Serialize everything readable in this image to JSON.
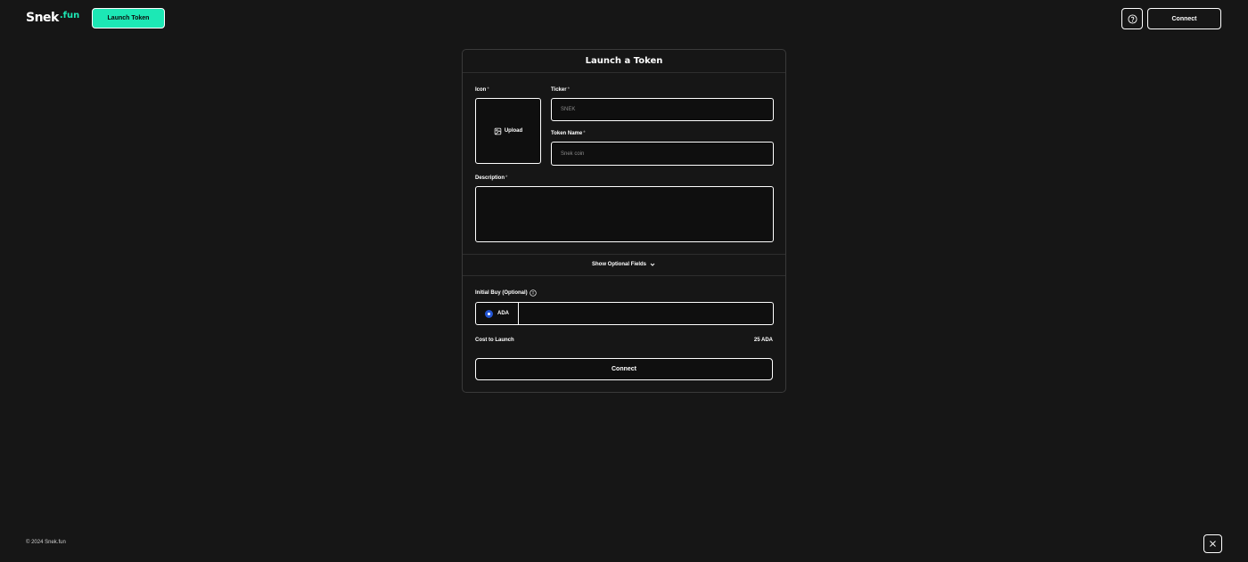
{
  "header": {
    "logo_main": "Snek",
    "logo_tld": ".fun",
    "launch_button": "Launch Token",
    "connect_button": "Connect",
    "help_icon": "question-circle-icon"
  },
  "form": {
    "title": "Launch a Token",
    "icon_label": "Icon",
    "upload_label": "Upload",
    "upload_icon": "image-icon",
    "ticker_label": "Ticker",
    "ticker_placeholder": "SNEK",
    "token_name_label": "Token Name",
    "token_name_placeholder": "Snek coin",
    "description_label": "Description",
    "description_value": "",
    "required_mark": "*",
    "optional_toggle": "Show Optional Fields",
    "optional_icon": "chevron-down-icon",
    "initial_buy_label": "Initial Buy (Optional)",
    "info_icon": "info-icon",
    "currency": "ADA",
    "currency_icon": "ada-coin-icon",
    "initial_buy_value": "",
    "cost_label": "Cost to Launch",
    "cost_value": "25 ADA",
    "connect_button": "Connect"
  },
  "footer": {
    "copyright": "© 2024 Snek.fun",
    "social_icon": "x-twitter-icon"
  },
  "colors": {
    "background": "#161616",
    "accent": "#1ce8b5",
    "border": "#ffffff",
    "ada_blue": "#2456d4"
  }
}
